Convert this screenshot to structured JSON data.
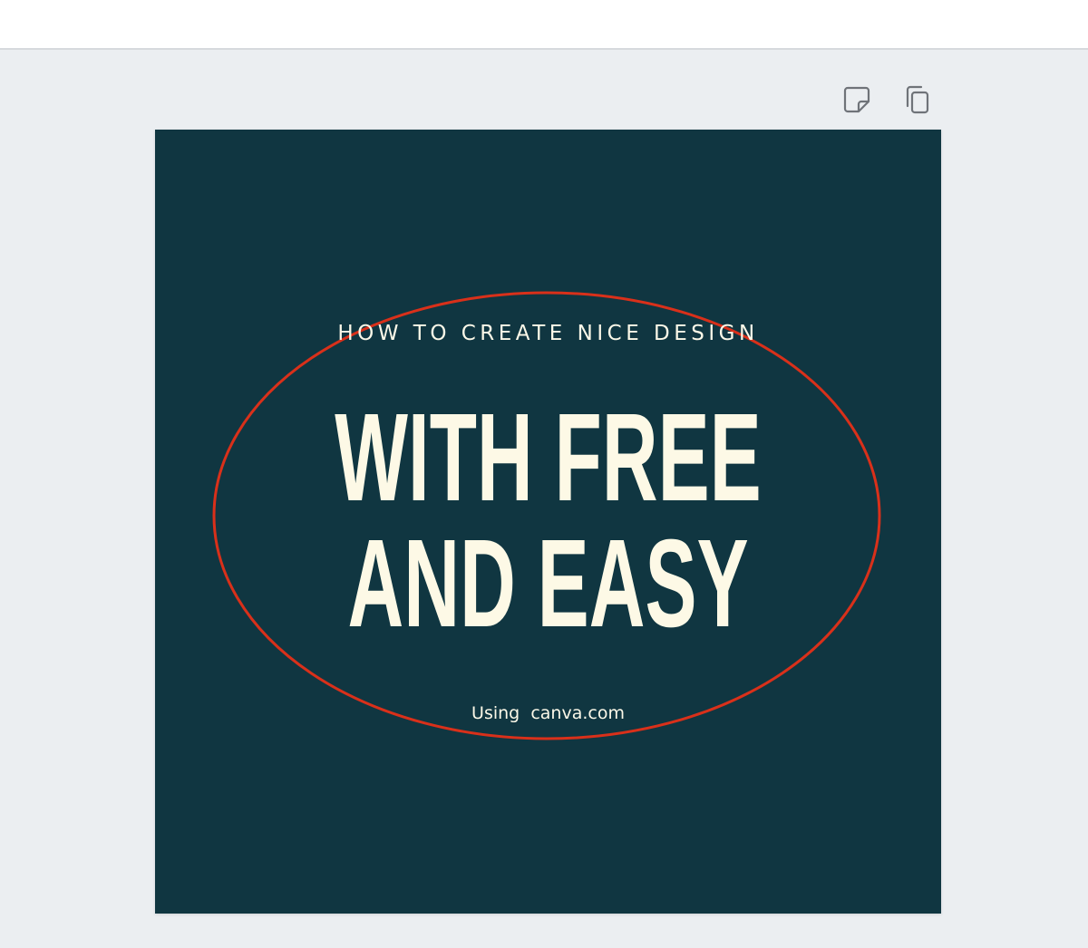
{
  "page": {
    "subtitle": "HOW TO CREATE NICE DESIGN",
    "headline_line1": "WITH FREE",
    "headline_line2": "AND EASY",
    "footer": "Using  canva.com"
  },
  "toolbar": {
    "notes_icon": "sticky-note-icon",
    "duplicate_icon": "duplicate-page-icon"
  },
  "colors": {
    "page_background": "#103641",
    "text": "#fdf9e6",
    "ellipse_stroke": "#d9301a",
    "workspace": "#ebeef1"
  }
}
